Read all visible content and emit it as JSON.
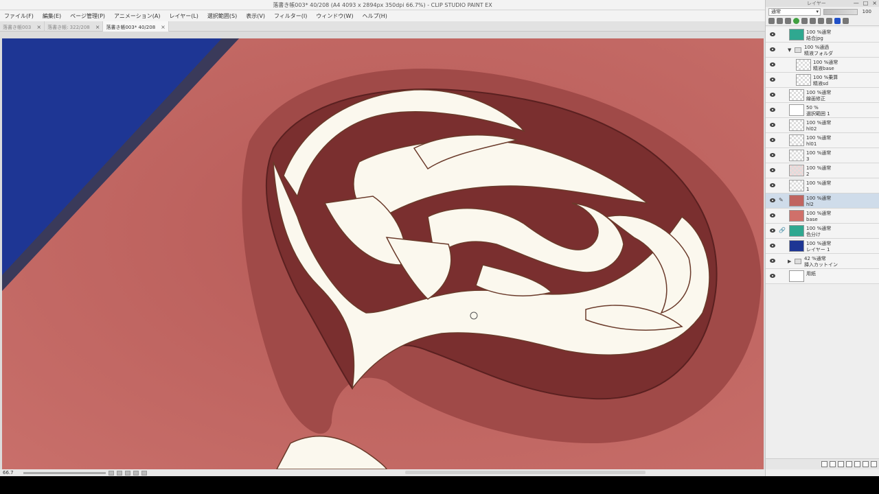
{
  "window": {
    "title": "落書き帳003* 40/208 (A4 4093 x 2894px 350dpi 66.7%) - CLIP STUDIO PAINT EX"
  },
  "menu": [
    {
      "label": "ファイル(F)"
    },
    {
      "label": "編集(E)"
    },
    {
      "label": "ページ管理(P)"
    },
    {
      "label": "アニメーション(A)"
    },
    {
      "label": "レイヤー(L)"
    },
    {
      "label": "選択範囲(S)"
    },
    {
      "label": "表示(V)"
    },
    {
      "label": "フィルター(I)"
    },
    {
      "label": "ウィンドウ(W)"
    },
    {
      "label": "ヘルプ(H)"
    }
  ],
  "tabs": [
    {
      "label": "落書き帳003",
      "close": "×"
    },
    {
      "label": "落書き帳: 322/208",
      "close": "×"
    },
    {
      "label": "落書き帳003* 40/208",
      "close": "×"
    }
  ],
  "status": {
    "zoom": "66.7"
  },
  "panel": {
    "title": "レイヤー",
    "window_buttons": [
      "—",
      "□",
      "×"
    ],
    "blend_mode": "通常",
    "opacity": "100"
  },
  "layers": [
    {
      "mode": "100 %通常",
      "name": "結合jpg",
      "thumb": "teal",
      "aux": ""
    },
    {
      "mode": "100 %通過",
      "name": "精液フォルダ",
      "folder": true,
      "aux": ""
    },
    {
      "mode": "100 %通常",
      "name": "精液base",
      "thumb": "check",
      "indent": true,
      "aux": ""
    },
    {
      "mode": "100 %乗算",
      "name": "精液sd",
      "thumb": "check",
      "indent": true,
      "aux": ""
    },
    {
      "mode": "100 %通常",
      "name": "線画修正",
      "thumb": "check",
      "aux": ""
    },
    {
      "mode": "50 %",
      "name": "選択範囲 1",
      "thumb": "select",
      "aux": ""
    },
    {
      "mode": "100 %通常",
      "name": "hl02",
      "thumb": "check",
      "aux": ""
    },
    {
      "mode": "100 %通常",
      "name": "hl01",
      "thumb": "check",
      "aux": ""
    },
    {
      "mode": "100 %通常",
      "name": "3",
      "thumb": "check",
      "aux": ""
    },
    {
      "mode": "100 %通常",
      "name": "2",
      "thumb": "check-red",
      "aux": ""
    },
    {
      "mode": "100 %通常",
      "name": "1",
      "thumb": "check",
      "aux": ""
    },
    {
      "mode": "100 %通常",
      "name": "hl2",
      "thumb": "red",
      "aux": "✎",
      "selected": true
    },
    {
      "mode": "100 %通常",
      "name": "base",
      "thumb": "red2",
      "aux": ""
    },
    {
      "mode": "100 %通常",
      "name": "色分け",
      "thumb": "teal",
      "aux": "🔗"
    },
    {
      "mode": "100 %通常",
      "name": "レイヤー 1",
      "thumb": "blue",
      "aux": ""
    },
    {
      "mode": "42 %通常",
      "name": "挿入カットイン",
      "folder": true,
      "collapsed": true,
      "aux": ""
    },
    {
      "mode": "",
      "name": "用紙",
      "thumb": "white",
      "aux": ""
    }
  ],
  "colors": {
    "canvas_skin": "#c06460",
    "blue_area": "#1f3a9a",
    "cream": "#fbf8ee",
    "dark_inner": "#7a2f2f"
  }
}
